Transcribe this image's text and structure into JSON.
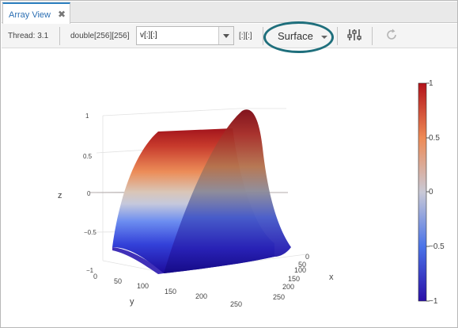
{
  "tab": {
    "label": "Array View",
    "close_glyph": "✖"
  },
  "toolbar": {
    "thread_label": "Thread: 3.1",
    "type_label": "double[256][256]",
    "expression": {
      "value": "v[:][:]"
    },
    "slice_label": "[:][:]",
    "view_mode": {
      "selected": "Surface"
    }
  },
  "icons": {
    "settings": "sliders-icon",
    "refresh": "refresh-icon"
  },
  "chart_data": {
    "type": "surface",
    "function": "z = sin(π·x/256)^p (approx. sinusoidal ridge surface)",
    "x": {
      "label": "x",
      "ticks": [
        "0",
        "50",
        "100",
        "150",
        "200",
        "250"
      ],
      "range": [
        0,
        255
      ]
    },
    "y": {
      "label": "y",
      "ticks": [
        "0",
        "50",
        "100",
        "150",
        "200",
        "250"
      ],
      "range": [
        0,
        255
      ]
    },
    "z": {
      "label": "z",
      "ticks": [
        "1",
        "0.5",
        "0",
        "−0.5",
        "−1"
      ],
      "range": [
        -1,
        1
      ]
    },
    "colorbar": {
      "ticks": [
        "1",
        "0.5",
        "0",
        "−0.5",
        "−1"
      ],
      "colormap": [
        "#2a0fa8",
        "#4a73e8",
        "#c9c9d6",
        "#ee8a55",
        "#b3121a"
      ]
    }
  }
}
